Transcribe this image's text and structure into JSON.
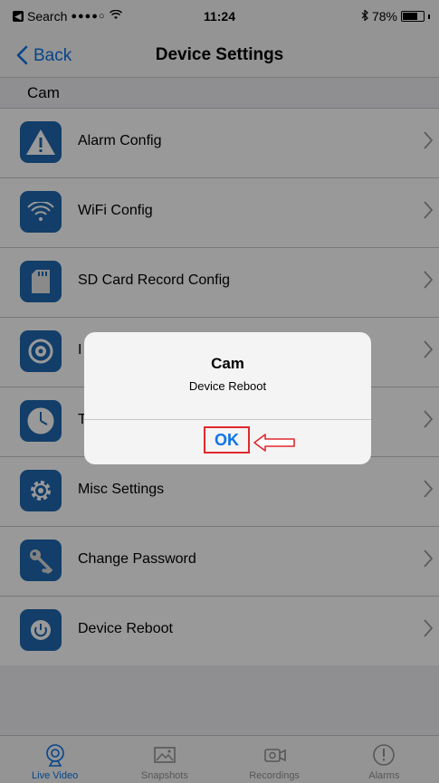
{
  "status_bar": {
    "carrier": "Search",
    "signal": "●●●●○",
    "time": "11:24",
    "battery_percent": "78%",
    "battery_level": 0.78
  },
  "nav": {
    "back_label": "Back",
    "title": "Device Settings"
  },
  "section": {
    "header": "Cam"
  },
  "settings": [
    {
      "label": "Alarm Config",
      "icon": "alarm-warning-icon"
    },
    {
      "label": "WiFi Config",
      "icon": "wifi-icon"
    },
    {
      "label": "SD Card Record Config",
      "icon": "sd-card-icon"
    },
    {
      "label": "I",
      "icon": "camera-lens-icon"
    },
    {
      "label": "T",
      "icon": "clock-icon"
    },
    {
      "label": "Misc Settings",
      "icon": "gear-icon"
    },
    {
      "label": "Change Password",
      "icon": "key-icon"
    },
    {
      "label": "Device Reboot",
      "icon": "reboot-icon"
    }
  ],
  "tabs": [
    {
      "label": "Live Video",
      "icon": "live-video-icon",
      "active": true
    },
    {
      "label": "Snapshots",
      "icon": "snapshots-icon",
      "active": false
    },
    {
      "label": "Recordings",
      "icon": "recordings-icon",
      "active": false
    },
    {
      "label": "Alarms",
      "icon": "alarms-icon",
      "active": false
    }
  ],
  "alert": {
    "title": "Cam",
    "message": "Device Reboot",
    "ok_label": "OK"
  },
  "colors": {
    "accent": "#0a74e8",
    "icon_bg": "#1e68b0",
    "annotation_red": "#e0282e"
  }
}
